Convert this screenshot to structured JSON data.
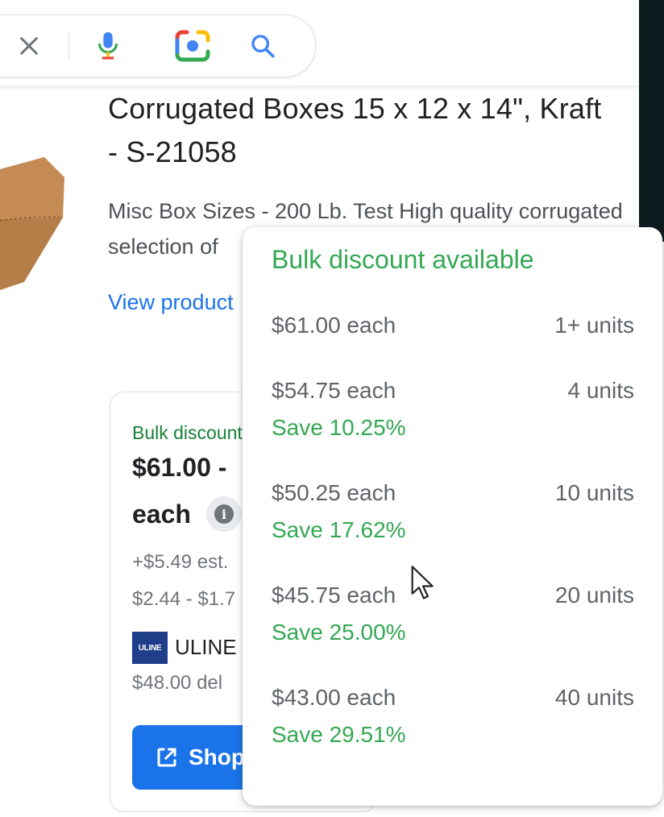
{
  "search_bar": {
    "icons": [
      "close-icon",
      "microphone-icon",
      "camera-lens-icon",
      "search-icon"
    ]
  },
  "product": {
    "title_line1": "Corrugated Boxes 15 x 12 x 14\", Kraft",
    "title_line2": "- S-21058",
    "description_line1": "Misc Box Sizes - 200 Lb. Test High quality corrugated",
    "description_line2": "selection of",
    "view_link": "View product"
  },
  "offer_card": {
    "bulk_label": "Bulk discount",
    "price": "$61.00 -",
    "each_label": "each",
    "info_glyph": "i",
    "shipping": "+$5.49 est.",
    "range": "$2.44 - $1.7",
    "seller_logo": "ULINE",
    "seller": "ULINE",
    "delivery": "$48.00 del",
    "shop_button": "Shop"
  },
  "popup": {
    "title": "Bulk discount available",
    "tiers": [
      {
        "price": "$61.00 each",
        "units": "1+ units",
        "save": ""
      },
      {
        "price": "$54.75 each",
        "units": "4 units",
        "save": "Save 10.25%"
      },
      {
        "price": "$50.25 each",
        "units": "10 units",
        "save": "Save 17.62%"
      },
      {
        "price": "$45.75 each",
        "units": "20 units",
        "save": "Save 25.00%"
      },
      {
        "price": "$43.00 each",
        "units": "40 units",
        "save": "Save 29.51%"
      }
    ]
  },
  "colors": {
    "accent_blue": "#1a73e8",
    "discount_green": "#34a853",
    "text_dark": "#202124",
    "text_muted": "#5f6368"
  }
}
